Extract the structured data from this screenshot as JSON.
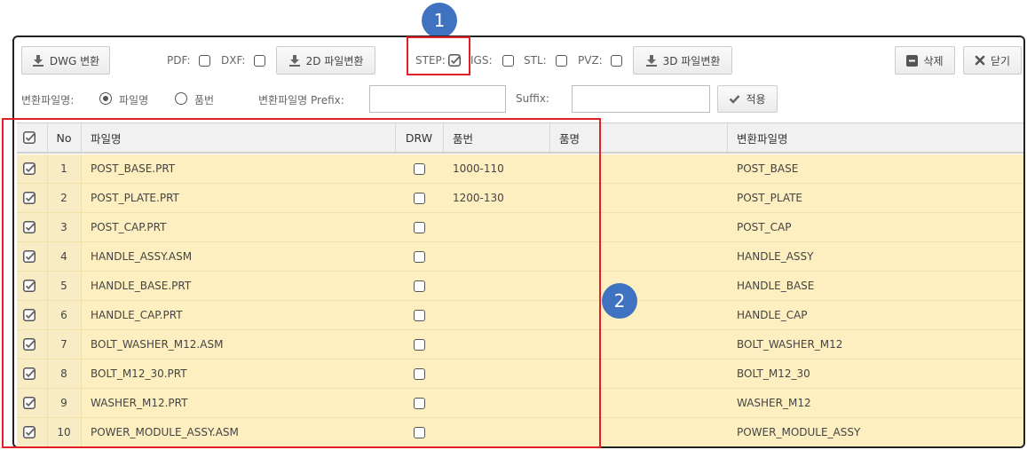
{
  "toolbar": {
    "dwg_button": "DWG 변환",
    "pdf_label": "PDF:",
    "dxf_label": "DXF:",
    "convert_2d_button": "2D 파일변환",
    "step_label": "STEP:",
    "igs_label": "IGS:",
    "stl_label": "STL:",
    "pvz_label": "PVZ:",
    "convert_3d_button": "3D 파일변환",
    "delete_button": "삭제",
    "close_button": "닫기"
  },
  "options": {
    "converted_name_label": "변환파일명:",
    "radio_filename": "파일명",
    "radio_partno": "품번",
    "prefix_label": "변환파일명 Prefix:",
    "prefix_value": "",
    "suffix_label": "Suffix:",
    "suffix_value": "",
    "apply_button": "적용"
  },
  "table": {
    "headers": {
      "no": "No",
      "filename": "파일명",
      "drw": "DRW",
      "part_no": "품번",
      "part_name": "품명",
      "converted_name": "변환파일명"
    },
    "rows": [
      {
        "no": "1",
        "filename": "POST_BASE.PRT",
        "part_no": "1000-110",
        "part_name": "",
        "converted": "POST_BASE"
      },
      {
        "no": "2",
        "filename": "POST_PLATE.PRT",
        "part_no": "1200-130",
        "part_name": "",
        "converted": "POST_PLATE"
      },
      {
        "no": "3",
        "filename": "POST_CAP.PRT",
        "part_no": "",
        "part_name": "",
        "converted": "POST_CAP"
      },
      {
        "no": "4",
        "filename": "HANDLE_ASSY.ASM",
        "part_no": "",
        "part_name": "",
        "converted": "HANDLE_ASSY"
      },
      {
        "no": "5",
        "filename": "HANDLE_BASE.PRT",
        "part_no": "",
        "part_name": "",
        "converted": "HANDLE_BASE"
      },
      {
        "no": "6",
        "filename": "HANDLE_CAP.PRT",
        "part_no": "",
        "part_name": "",
        "converted": "HANDLE_CAP"
      },
      {
        "no": "7",
        "filename": "BOLT_WASHER_M12.ASM",
        "part_no": "",
        "part_name": "",
        "converted": "BOLT_WASHER_M12"
      },
      {
        "no": "8",
        "filename": "BOLT_M12_30.PRT",
        "part_no": "",
        "part_name": "",
        "converted": "BOLT_M12_30"
      },
      {
        "no": "9",
        "filename": "WASHER_M12.PRT",
        "part_no": "",
        "part_name": "",
        "converted": "WASHER_M12"
      },
      {
        "no": "10",
        "filename": "POWER_MODULE_ASSY.ASM",
        "part_no": "",
        "part_name": "",
        "converted": "POWER_MODULE_ASSY"
      }
    ]
  },
  "callouts": {
    "badge_1": "1",
    "badge_2": "2",
    "accent_color": "#3f73c2",
    "highlight_color": "#e31e24"
  },
  "colors": {
    "row_background": "#fdefbf",
    "header_background": "#f1f1f1"
  }
}
